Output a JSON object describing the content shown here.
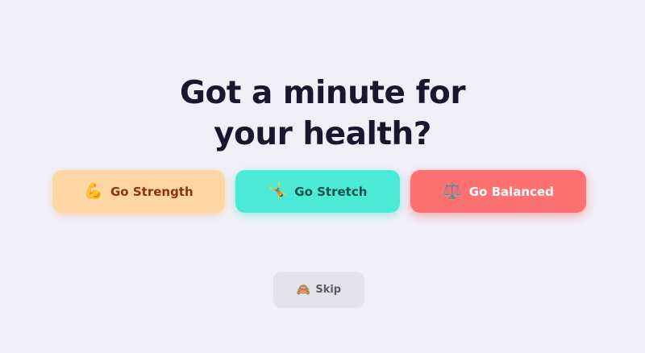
{
  "headline": {
    "line1": "Got a minute for",
    "line2": "your health?"
  },
  "options": [
    {
      "icon": "flexed-biceps-icon",
      "emoji": "💪",
      "label": "Go Strength"
    },
    {
      "icon": "person-stretching-icon",
      "emoji": "🤸",
      "label": "Go Stretch"
    },
    {
      "icon": "balance-scale-icon",
      "emoji": "⚖️",
      "label": "Go Balanced"
    }
  ],
  "skip": {
    "icon": "see-no-evil-monkey-icon",
    "emoji": "🙈",
    "label": "Skip"
  },
  "colors": {
    "background": "#f0eff8",
    "headline": "#1b1530",
    "strength_bg": "#fed5a4",
    "strength_text": "#8a3412",
    "stretch_bg": "#4ce9d6",
    "stretch_text": "#12514a",
    "balanced_bg": "#fd7172",
    "balanced_text": "#ffffff",
    "skip_bg": "#e4e3ec",
    "skip_text": "#5d5b6a"
  }
}
